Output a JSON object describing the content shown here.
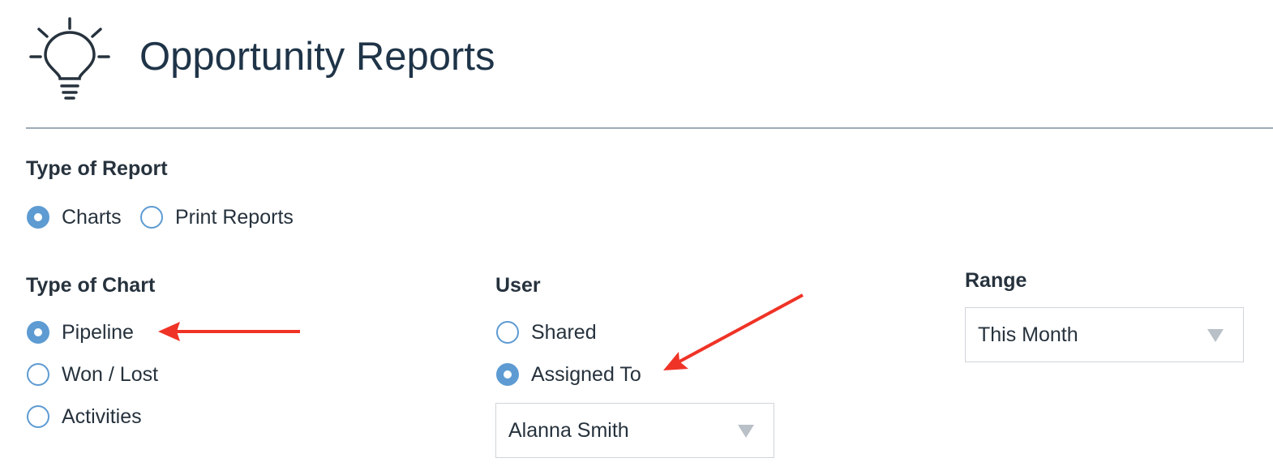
{
  "header": {
    "title": "Opportunity Reports",
    "icon": "lightbulb-icon"
  },
  "report_type": {
    "label": "Type of Report",
    "options": [
      {
        "label": "Charts",
        "checked": true
      },
      {
        "label": "Print Reports",
        "checked": false
      }
    ]
  },
  "chart_type": {
    "label": "Type of Chart",
    "options": [
      {
        "label": "Pipeline",
        "checked": true
      },
      {
        "label": "Won / Lost",
        "checked": false
      },
      {
        "label": "Activities",
        "checked": false
      }
    ]
  },
  "user": {
    "label": "User",
    "options": [
      {
        "label": "Shared",
        "checked": false
      },
      {
        "label": "Assigned To",
        "checked": true
      }
    ],
    "assignee_select": {
      "value": "Alanna Smith"
    }
  },
  "range": {
    "label": "Range",
    "select": {
      "value": "This Month"
    }
  },
  "colors": {
    "accent": "#5d9bd2",
    "annotation_arrow": "#ef3326",
    "title": "#1f3448",
    "divider": "#9eabb7"
  }
}
